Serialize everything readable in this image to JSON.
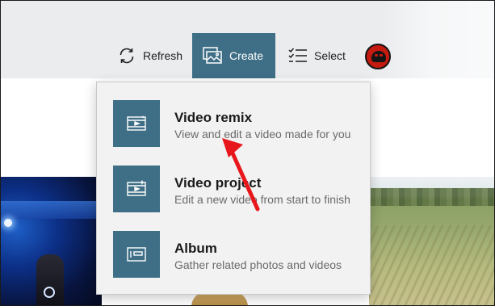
{
  "toolbar": {
    "refresh_label": "Refresh",
    "create_label": "Create",
    "select_label": "Select",
    "create_active_color": "#3e6f86"
  },
  "flyout": {
    "items": [
      {
        "title": "Video remix",
        "subtitle": "View and edit a video made for you",
        "icon": "video-remix-icon"
      },
      {
        "title": "Video project",
        "subtitle": "Edit a new video from start to finish",
        "icon": "video-project-icon"
      },
      {
        "title": "Album",
        "subtitle": "Gather related photos and videos",
        "icon": "album-icon"
      }
    ]
  },
  "annotation": {
    "arrow_color": "#e8171c"
  }
}
